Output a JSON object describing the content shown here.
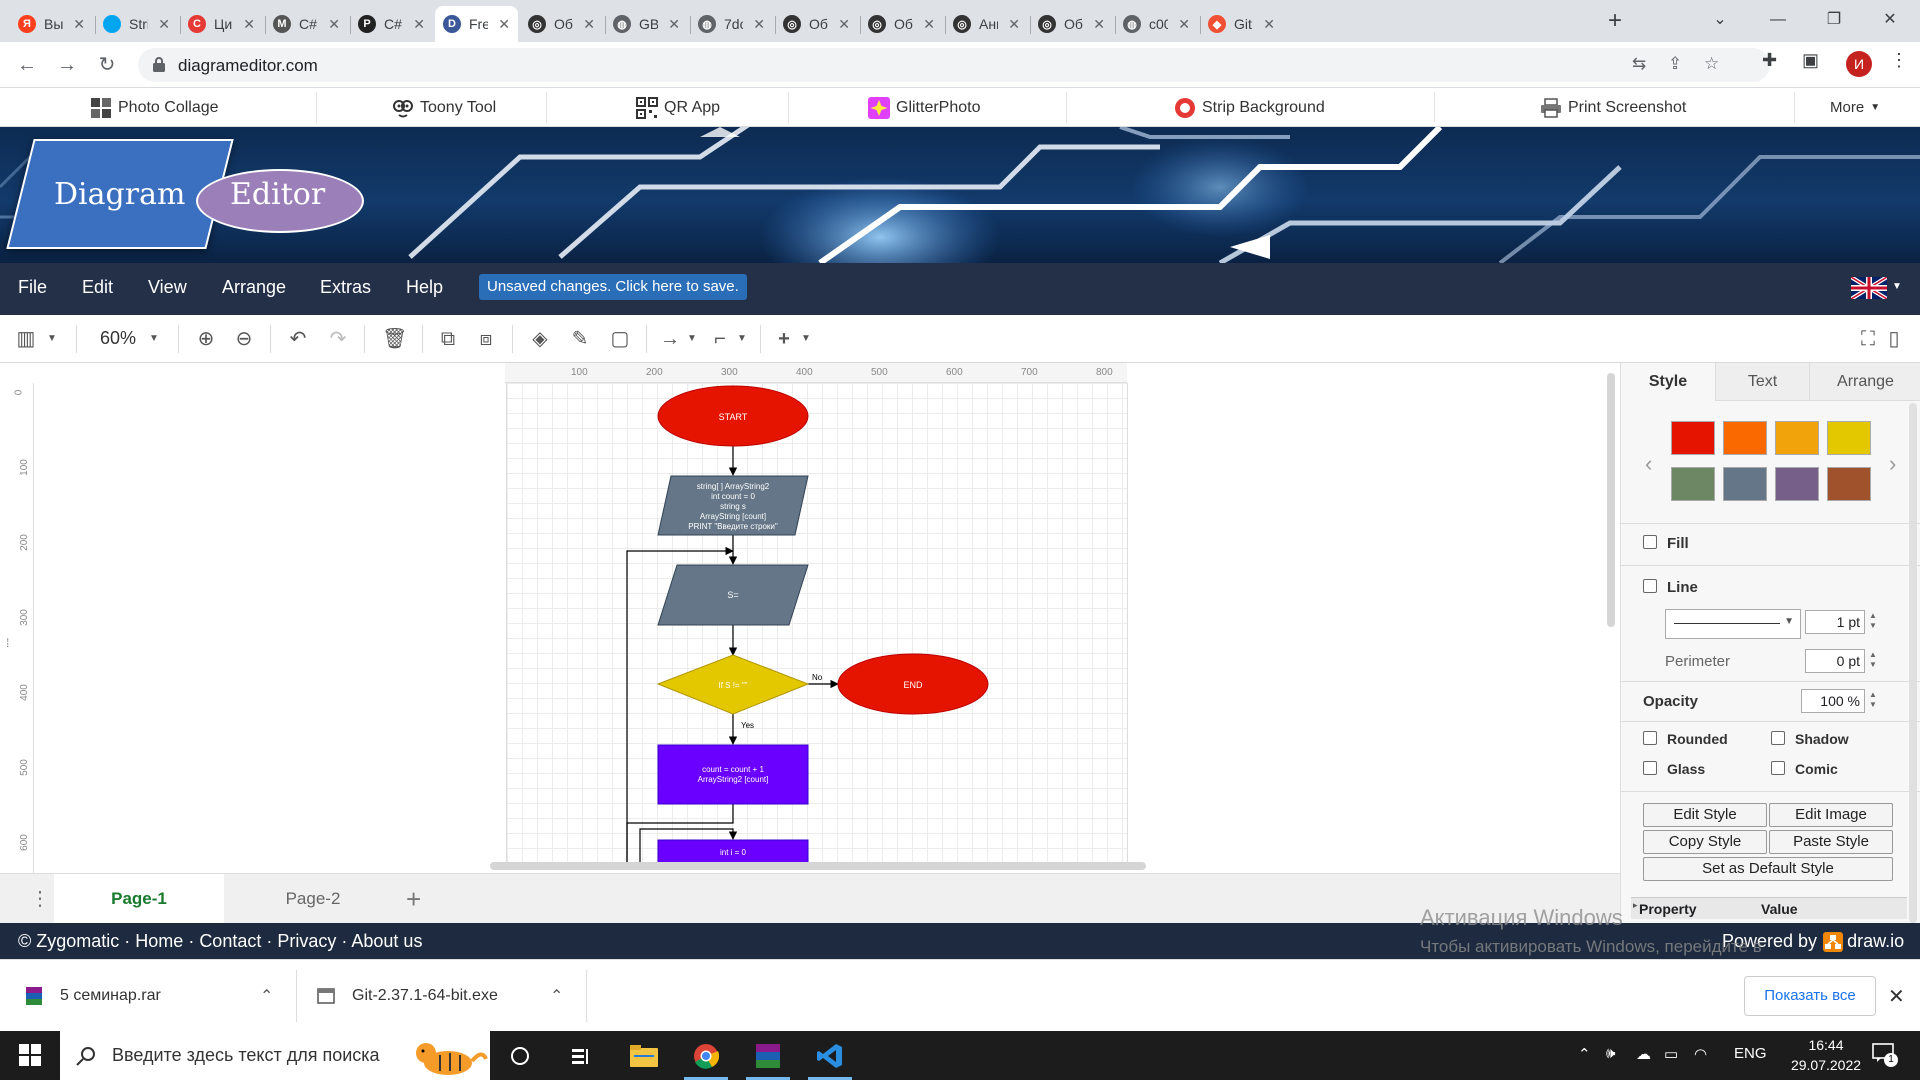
{
  "browser": {
    "tabs": [
      {
        "label": "Выб",
        "icon": "yandex-icon",
        "color": "#fc3f1d",
        "glyph": "Я"
      },
      {
        "label": "Strin",
        "icon": "microsoft-icon",
        "color": "#00a4ef",
        "glyph": ""
      },
      {
        "label": "Цик",
        "icon": "csharp-site-icon",
        "color": "#e53935",
        "glyph": "C"
      },
      {
        "label": "C# |",
        "icon": "gmail-icon",
        "color": "#555555",
        "glyph": "M"
      },
      {
        "label": "C#.",
        "icon": "code-icon",
        "color": "#222222",
        "glyph": "P"
      },
      {
        "label": "Free",
        "icon": "diagram-icon",
        "color": "#3b5998",
        "glyph": "D",
        "active": true
      },
      {
        "label": "Обу",
        "icon": "openai-icon",
        "color": "#333333",
        "glyph": "◎"
      },
      {
        "label": "GB_",
        "icon": "globe-icon",
        "color": "#5f6368",
        "glyph": "◍"
      },
      {
        "label": "7dc",
        "icon": "globe-icon",
        "color": "#5f6368",
        "glyph": "◍"
      },
      {
        "label": "Обу",
        "icon": "openai-icon",
        "color": "#333333",
        "glyph": "◎"
      },
      {
        "label": "Обу",
        "icon": "openai-icon",
        "color": "#333333",
        "glyph": "◎"
      },
      {
        "label": "Анк",
        "icon": "openai-icon",
        "color": "#333333",
        "glyph": "◎"
      },
      {
        "label": "Обу",
        "icon": "openai-icon",
        "color": "#333333",
        "glyph": "◎"
      },
      {
        "label": "c00",
        "icon": "globe-icon",
        "color": "#5f6368",
        "glyph": "◍"
      },
      {
        "label": "Git",
        "icon": "git-icon",
        "color": "#f05033",
        "glyph": "◆"
      }
    ],
    "url": "diagrameditor.com",
    "profile_initial": "И"
  },
  "sitenav": {
    "links": [
      "Photo Collage",
      "Toony Tool",
      "QR App",
      "GlitterPhoto",
      "Strip Background",
      "Print Screenshot"
    ],
    "more": "More"
  },
  "banner": {
    "logo_left": "Diagram",
    "logo_right": "Editor"
  },
  "menu": {
    "items": [
      "File",
      "Edit",
      "View",
      "Arrange",
      "Extras",
      "Help"
    ],
    "unsaved": "Unsaved changes. Click here to save."
  },
  "toolbar": {
    "zoom": "60%"
  },
  "rulers": {
    "h": [
      "100",
      "200",
      "300",
      "400",
      "500",
      "600",
      "700",
      "800"
    ],
    "v": [
      "0",
      "100",
      "200",
      "300",
      "400",
      "500",
      "600"
    ]
  },
  "flowchart": {
    "start": "START",
    "input1": [
      "string[ ] ArrayString2",
      "int count = 0",
      "string s",
      "ArrayString [count]",
      "PRINT \"Введите строки\""
    ],
    "input2": "S=",
    "decision": "If S != \"\"",
    "no_label": "No",
    "yes_label": "Yes",
    "end": "END",
    "process1": [
      "count = count + 1",
      "ArrayString2 [count]"
    ],
    "process2": "int i = 0"
  },
  "pages": {
    "tabs": [
      "Page-1",
      "Page-2"
    ]
  },
  "panel": {
    "tabs": [
      "Style",
      "Text",
      "Arrange"
    ],
    "swatches": [
      "#e51400",
      "#fa6800",
      "#f0a30a",
      "#e3c800",
      "#6d8764",
      "#647687",
      "#76608a",
      "#a0522d"
    ],
    "fill": "Fill",
    "line": "Line",
    "line_width": "1 pt",
    "perimeter": "Perimeter",
    "perimeter_value": "0 pt",
    "opacity": "Opacity",
    "opacity_value": "100 %",
    "rounded": "Rounded",
    "shadow": "Shadow",
    "glass": "Glass",
    "comic": "Comic",
    "buttons": [
      "Edit Style",
      "Edit Image",
      "Copy Style",
      "Paste Style"
    ],
    "default_style": "Set as Default Style",
    "property": "Property",
    "value": "Value"
  },
  "footer": {
    "links": [
      "© Zygomatic",
      "Home",
      "Contact",
      "Privacy",
      "About us"
    ],
    "powered": "Powered by",
    "powered_brand": "draw.io"
  },
  "watermark": {
    "title": "Активация Windows",
    "body": "Чтобы активировать Windows, перейдите в раздел \"Параметры\"."
  },
  "downloads": {
    "items": [
      "5 семинар.rar",
      "Git-2.37.1-64-bit.exe"
    ],
    "show_all": "Показать все"
  },
  "taskbar": {
    "search_placeholder": "Введите здесь текст для поиска",
    "lang": "ENG",
    "time": "16:44",
    "date": "29.07.2022",
    "notifications": "1"
  }
}
